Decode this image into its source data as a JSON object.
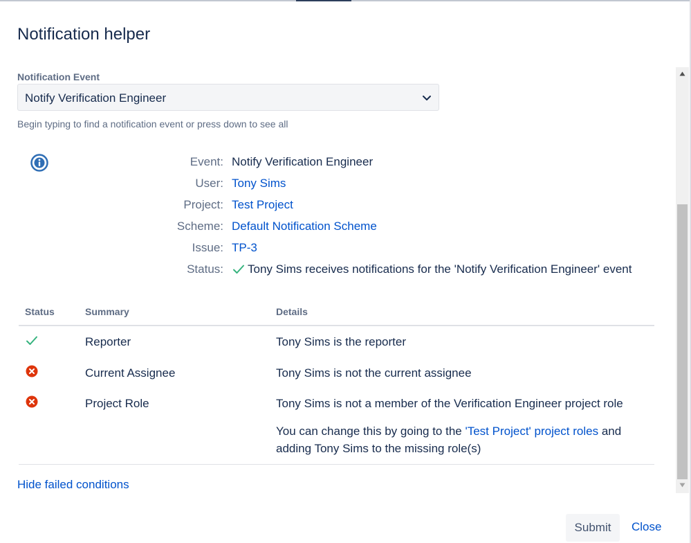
{
  "dialog": {
    "title": "Notification helper"
  },
  "event_field": {
    "label": "Notification Event",
    "selected": "Notify Verification Engineer",
    "help": "Begin typing to find a notification event or press down to see all"
  },
  "summary": {
    "rows": [
      {
        "label": "Event:",
        "value": "Notify Verification Engineer"
      },
      {
        "label": "User:",
        "value": "Tony Sims"
      },
      {
        "label": "Project:",
        "value": "Test Project"
      },
      {
        "label": "Scheme:",
        "value": "Default Notification Scheme"
      },
      {
        "label": "Issue:",
        "value": "TP-3"
      },
      {
        "label": "Status:",
        "value": "Tony Sims receives notifications for the 'Notify Verification Engineer' event"
      }
    ]
  },
  "table": {
    "headers": {
      "status": "Status",
      "summary": "Summary",
      "details": "Details"
    },
    "rows": [
      {
        "status": "pass",
        "summary": "Reporter",
        "details": "Tony Sims is the reporter"
      },
      {
        "status": "fail",
        "summary": "Current Assignee",
        "details": "Tony Sims is not the current assignee"
      },
      {
        "status": "fail",
        "summary": "Project Role",
        "details": "Tony Sims is not a member of the Verification Engineer project role"
      }
    ],
    "note": {
      "prefix": "You can change this by going to the ",
      "link": "'Test Project' project roles",
      "suffix": " and",
      "line2": "adding Tony Sims to the missing role(s)"
    }
  },
  "footer": {
    "hide_link": "Hide failed conditions",
    "submit_label": "Submit",
    "close_label": "Close"
  },
  "icons": {
    "info": "info-icon",
    "pass": "check-icon",
    "fail": "error-icon",
    "chevron": "chevron-down-icon"
  },
  "colors": {
    "link": "#0052cc",
    "success": "#36b37e",
    "error": "#de350b",
    "info": "#0052cc"
  }
}
